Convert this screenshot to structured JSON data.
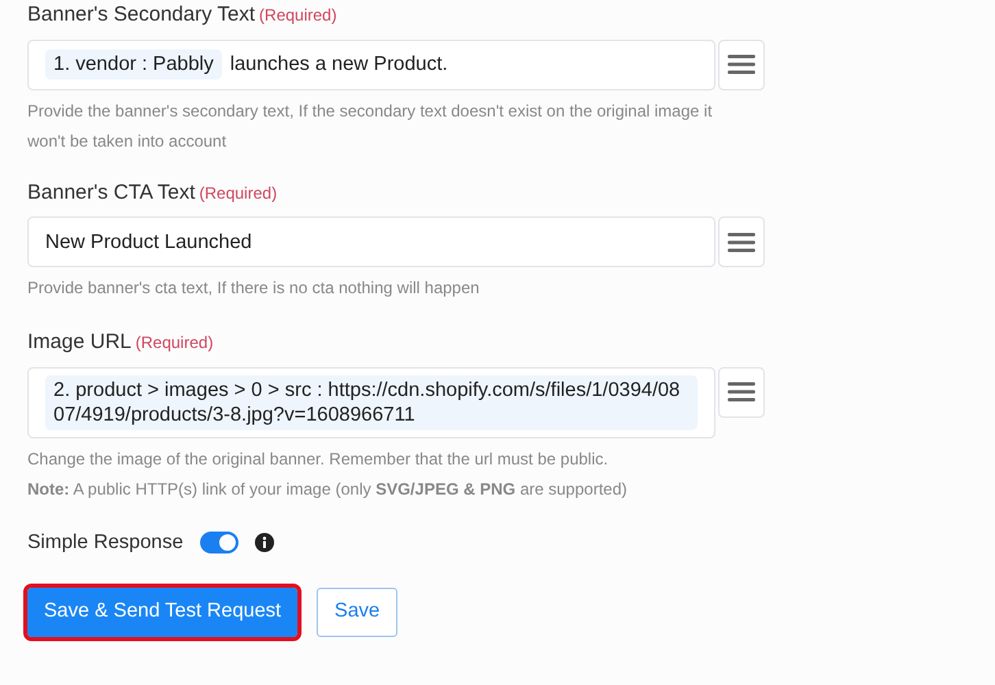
{
  "fields": [
    {
      "label": "Banner's Secondary Text",
      "required": "(Required)",
      "parts": [
        {
          "kind": "token",
          "text": "1. vendor : Pabbly"
        },
        {
          "kind": "text",
          "text": "launches a new Product."
        }
      ],
      "hints": [
        "Provide the banner's secondary text, If the secondary text doesn't exist on the original image it won't be taken into account"
      ]
    },
    {
      "label": "Banner's CTA Text",
      "required": "(Required)",
      "parts": [
        {
          "kind": "text",
          "text": "New Product Launched"
        }
      ],
      "hints": [
        "Provide banner's cta text, If there is no cta nothing will happen"
      ]
    },
    {
      "label": "Image URL",
      "required": "(Required)",
      "parts": [
        {
          "kind": "token",
          "text": "2. product > images > 0 > src : https://cdn.shopify.com/s/files/1/0394/0807/4919/products/3-8.jpg?v=1608966711"
        }
      ],
      "hints": [
        "Change the image of the original banner. Remember that the url must be public.",
        "**Note:** A public HTTP(s) link of your image (only **SVG/JPEG & PNG** are supported)"
      ]
    }
  ],
  "simple_response": {
    "label": "Simple Response",
    "on": true
  },
  "buttons": [
    {
      "label": "Save & Send Test Request",
      "kind": "primary",
      "highlighted": true
    },
    {
      "label": "Save",
      "kind": "outline",
      "highlighted": false
    }
  ]
}
